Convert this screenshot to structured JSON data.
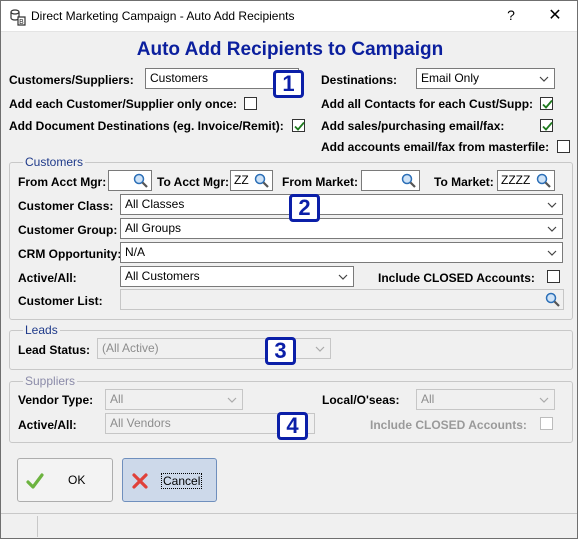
{
  "window": {
    "title": "Direct Marketing Campaign - Auto Add Recipients",
    "help_glyph": "?",
    "close_glyph": "✕",
    "app_icon": "database-icon"
  },
  "heading": "Auto Add Recipients to Campaign",
  "top": {
    "customers_suppliers_label": "Customers/Suppliers:",
    "customers_suppliers_value": "Customers",
    "destinations_label": "Destinations:",
    "destinations_value": "Email Only",
    "add_each_once_label": "Add each Customer/Supplier only once:",
    "add_each_once_checked": false,
    "add_all_contacts_label": "Add all Contacts for each Cust/Supp:",
    "add_all_contacts_checked": true,
    "add_doc_destinations_label": "Add Document Destinations (eg. Invoice/Remit):",
    "add_doc_destinations_checked": true,
    "add_sales_purchasing_label": "Add sales/purchasing email/fax:",
    "add_sales_purchasing_checked": true,
    "add_accounts_label": "Add accounts email/fax from masterfile:",
    "add_accounts_checked": false
  },
  "customers": {
    "legend": "Customers",
    "from_acct_mgr_label": "From Acct Mgr:",
    "from_acct_mgr_value": "",
    "to_acct_mgr_label": "To Acct Mgr:",
    "to_acct_mgr_value": "ZZ",
    "from_market_label": "From Market:",
    "from_market_value": "",
    "to_market_label": "To Market:",
    "to_market_value": "ZZZZ",
    "customer_class_label": "Customer Class:",
    "customer_class_value": "All Classes",
    "customer_group_label": "Customer Group:",
    "customer_group_value": "All Groups",
    "crm_opportunity_label": "CRM Opportunity:",
    "crm_opportunity_value": "N/A",
    "active_all_label": "Active/All:",
    "active_all_value": "All Customers",
    "include_closed_label": "Include CLOSED Accounts:",
    "include_closed_checked": false,
    "customer_list_label": "Customer List:",
    "customer_list_value": ""
  },
  "leads": {
    "legend": "Leads",
    "lead_status_label": "Lead Status:",
    "lead_status_value": "(All Active)"
  },
  "suppliers": {
    "legend": "Suppliers",
    "vendor_type_label": "Vendor Type:",
    "vendor_type_value": "All",
    "local_overseas_label": "Local/O'seas:",
    "local_overseas_value": "All",
    "active_all_label": "Active/All:",
    "active_all_value": "All Vendors",
    "include_closed_label": "Include CLOSED Accounts:",
    "include_closed_checked": false
  },
  "badges": [
    "1",
    "2",
    "3",
    "4"
  ],
  "buttons": {
    "ok_label": "OK",
    "cancel_label": "Cancel"
  },
  "colors": {
    "heading": "#0b1f9e",
    "badge": "#0b1fa8",
    "check": "#1e7a1e",
    "cancel_bg": "#cdd9ea"
  }
}
